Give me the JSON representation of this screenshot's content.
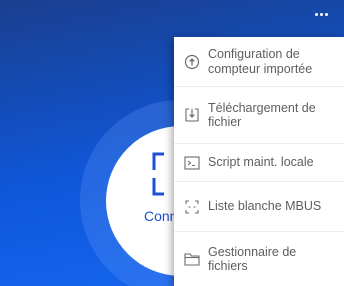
{
  "menu": {
    "items": [
      {
        "label": "Configuration de compteur importée",
        "icon": "upload-circle-icon"
      },
      {
        "label": "Téléchargement de fichier",
        "icon": "download-file-icon"
      },
      {
        "label": "Script maint. locale",
        "icon": "terminal-icon"
      },
      {
        "label": "Liste blanche MBUS",
        "icon": "bracket-list-icon"
      },
      {
        "label": "Gestionnaire de fichiers",
        "icon": "folder-icon"
      }
    ]
  },
  "connect": {
    "label": "Conn"
  },
  "icons": {
    "more": "more-horizontal-icon",
    "connect": "connect-bracket-icon"
  },
  "colors": {
    "background": "#0f57d9",
    "accent": "#1a4fd4",
    "menu_text": "#5e5e5e"
  }
}
